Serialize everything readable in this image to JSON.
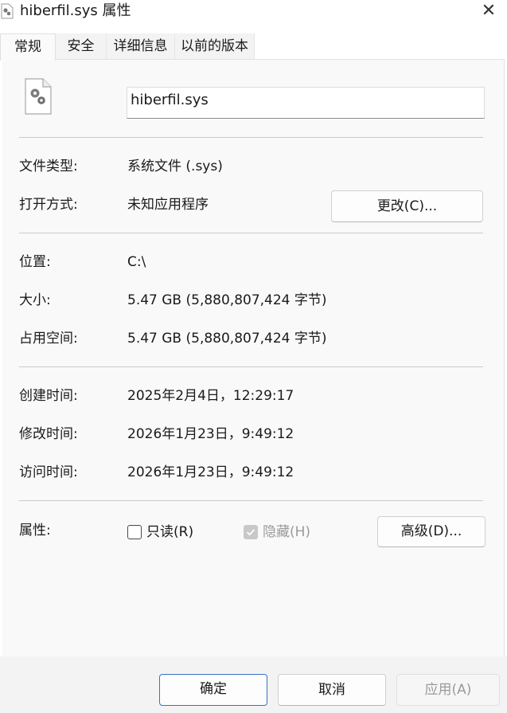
{
  "window": {
    "title": "hiberfil.sys 属性",
    "close_symbol": "✕"
  },
  "tabs": [
    {
      "label": "常规",
      "active": true
    },
    {
      "label": "安全",
      "active": false
    },
    {
      "label": "详细信息",
      "active": false
    },
    {
      "label": "以前的版本",
      "active": false
    }
  ],
  "general": {
    "file_icon": "system-file-gear-icon",
    "file_name": "hiberfil.sys",
    "type_label": "文件类型:",
    "type_value": "系统文件 (.sys)",
    "opens_with_label": "打开方式:",
    "opens_with_value": "未知应用程序",
    "change_button": "更改(C)...",
    "location_label": "位置:",
    "location_value": "C:\\",
    "size_label": "大小:",
    "size_value": "5.47 GB (5,880,807,424 字节)",
    "size_on_disk_label": "占用空间:",
    "size_on_disk_value": "5.47 GB (5,880,807,424 字节)",
    "created_label": "创建时间:",
    "created_value": "2025年2月4日，12:29:17",
    "modified_label": "修改时间:",
    "modified_value": "2026年1月23日，9:49:12",
    "accessed_label": "访问时间:",
    "accessed_value": "2026年1月23日，9:49:12",
    "attributes_label": "属性:",
    "readonly_label": "只读(R)",
    "readonly_checked": false,
    "hidden_label": "隐藏(H)",
    "hidden_checked": true,
    "hidden_disabled": true,
    "advanced_button": "高级(D)..."
  },
  "footer": {
    "ok_button": "确定",
    "cancel_button": "取消",
    "apply_button": "应用(A)"
  },
  "colors": {
    "primary_border": "#3a72c4",
    "panel_bg": "#f9f9f9",
    "disabled_text": "#9a9a9a"
  }
}
